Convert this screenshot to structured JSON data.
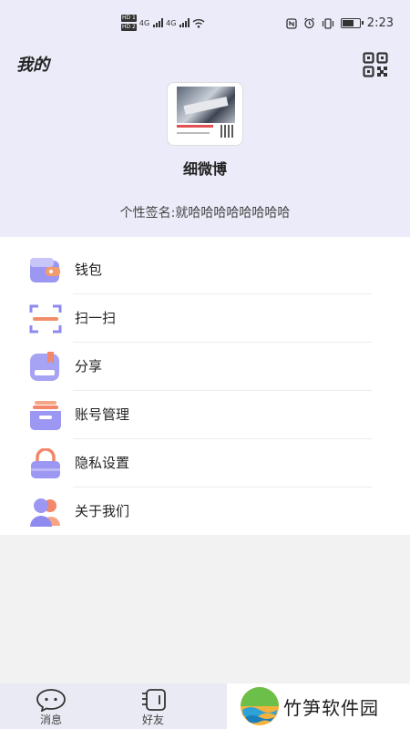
{
  "status_bar": {
    "hd1": "HD 1",
    "hd2": "HD 2",
    "net1": "4G",
    "net2": "4G",
    "time": "2:23"
  },
  "header": {
    "title": "我的",
    "username": "细微博",
    "signature": "个性签名:就哈哈哈哈哈哈哈哈"
  },
  "menu": {
    "items": [
      {
        "label": "钱包",
        "icon": "wallet-icon"
      },
      {
        "label": "扫一扫",
        "icon": "scan-icon"
      },
      {
        "label": "分享",
        "icon": "share-icon"
      },
      {
        "label": "账号管理",
        "icon": "account-management-icon"
      },
      {
        "label": "隐私设置",
        "icon": "privacy-lock-icon"
      },
      {
        "label": "关于我们",
        "icon": "about-us-icon"
      }
    ]
  },
  "tabbar": {
    "tabs": [
      {
        "label": "消息",
        "icon": "message-icon"
      },
      {
        "label": "好友",
        "icon": "friends-icon"
      }
    ]
  },
  "watermark": {
    "text": "竹笋软件园"
  },
  "colors": {
    "header_bg": "#ebebfa",
    "accent_purple": "#8b86f0",
    "accent_orange": "#f08a5d"
  }
}
